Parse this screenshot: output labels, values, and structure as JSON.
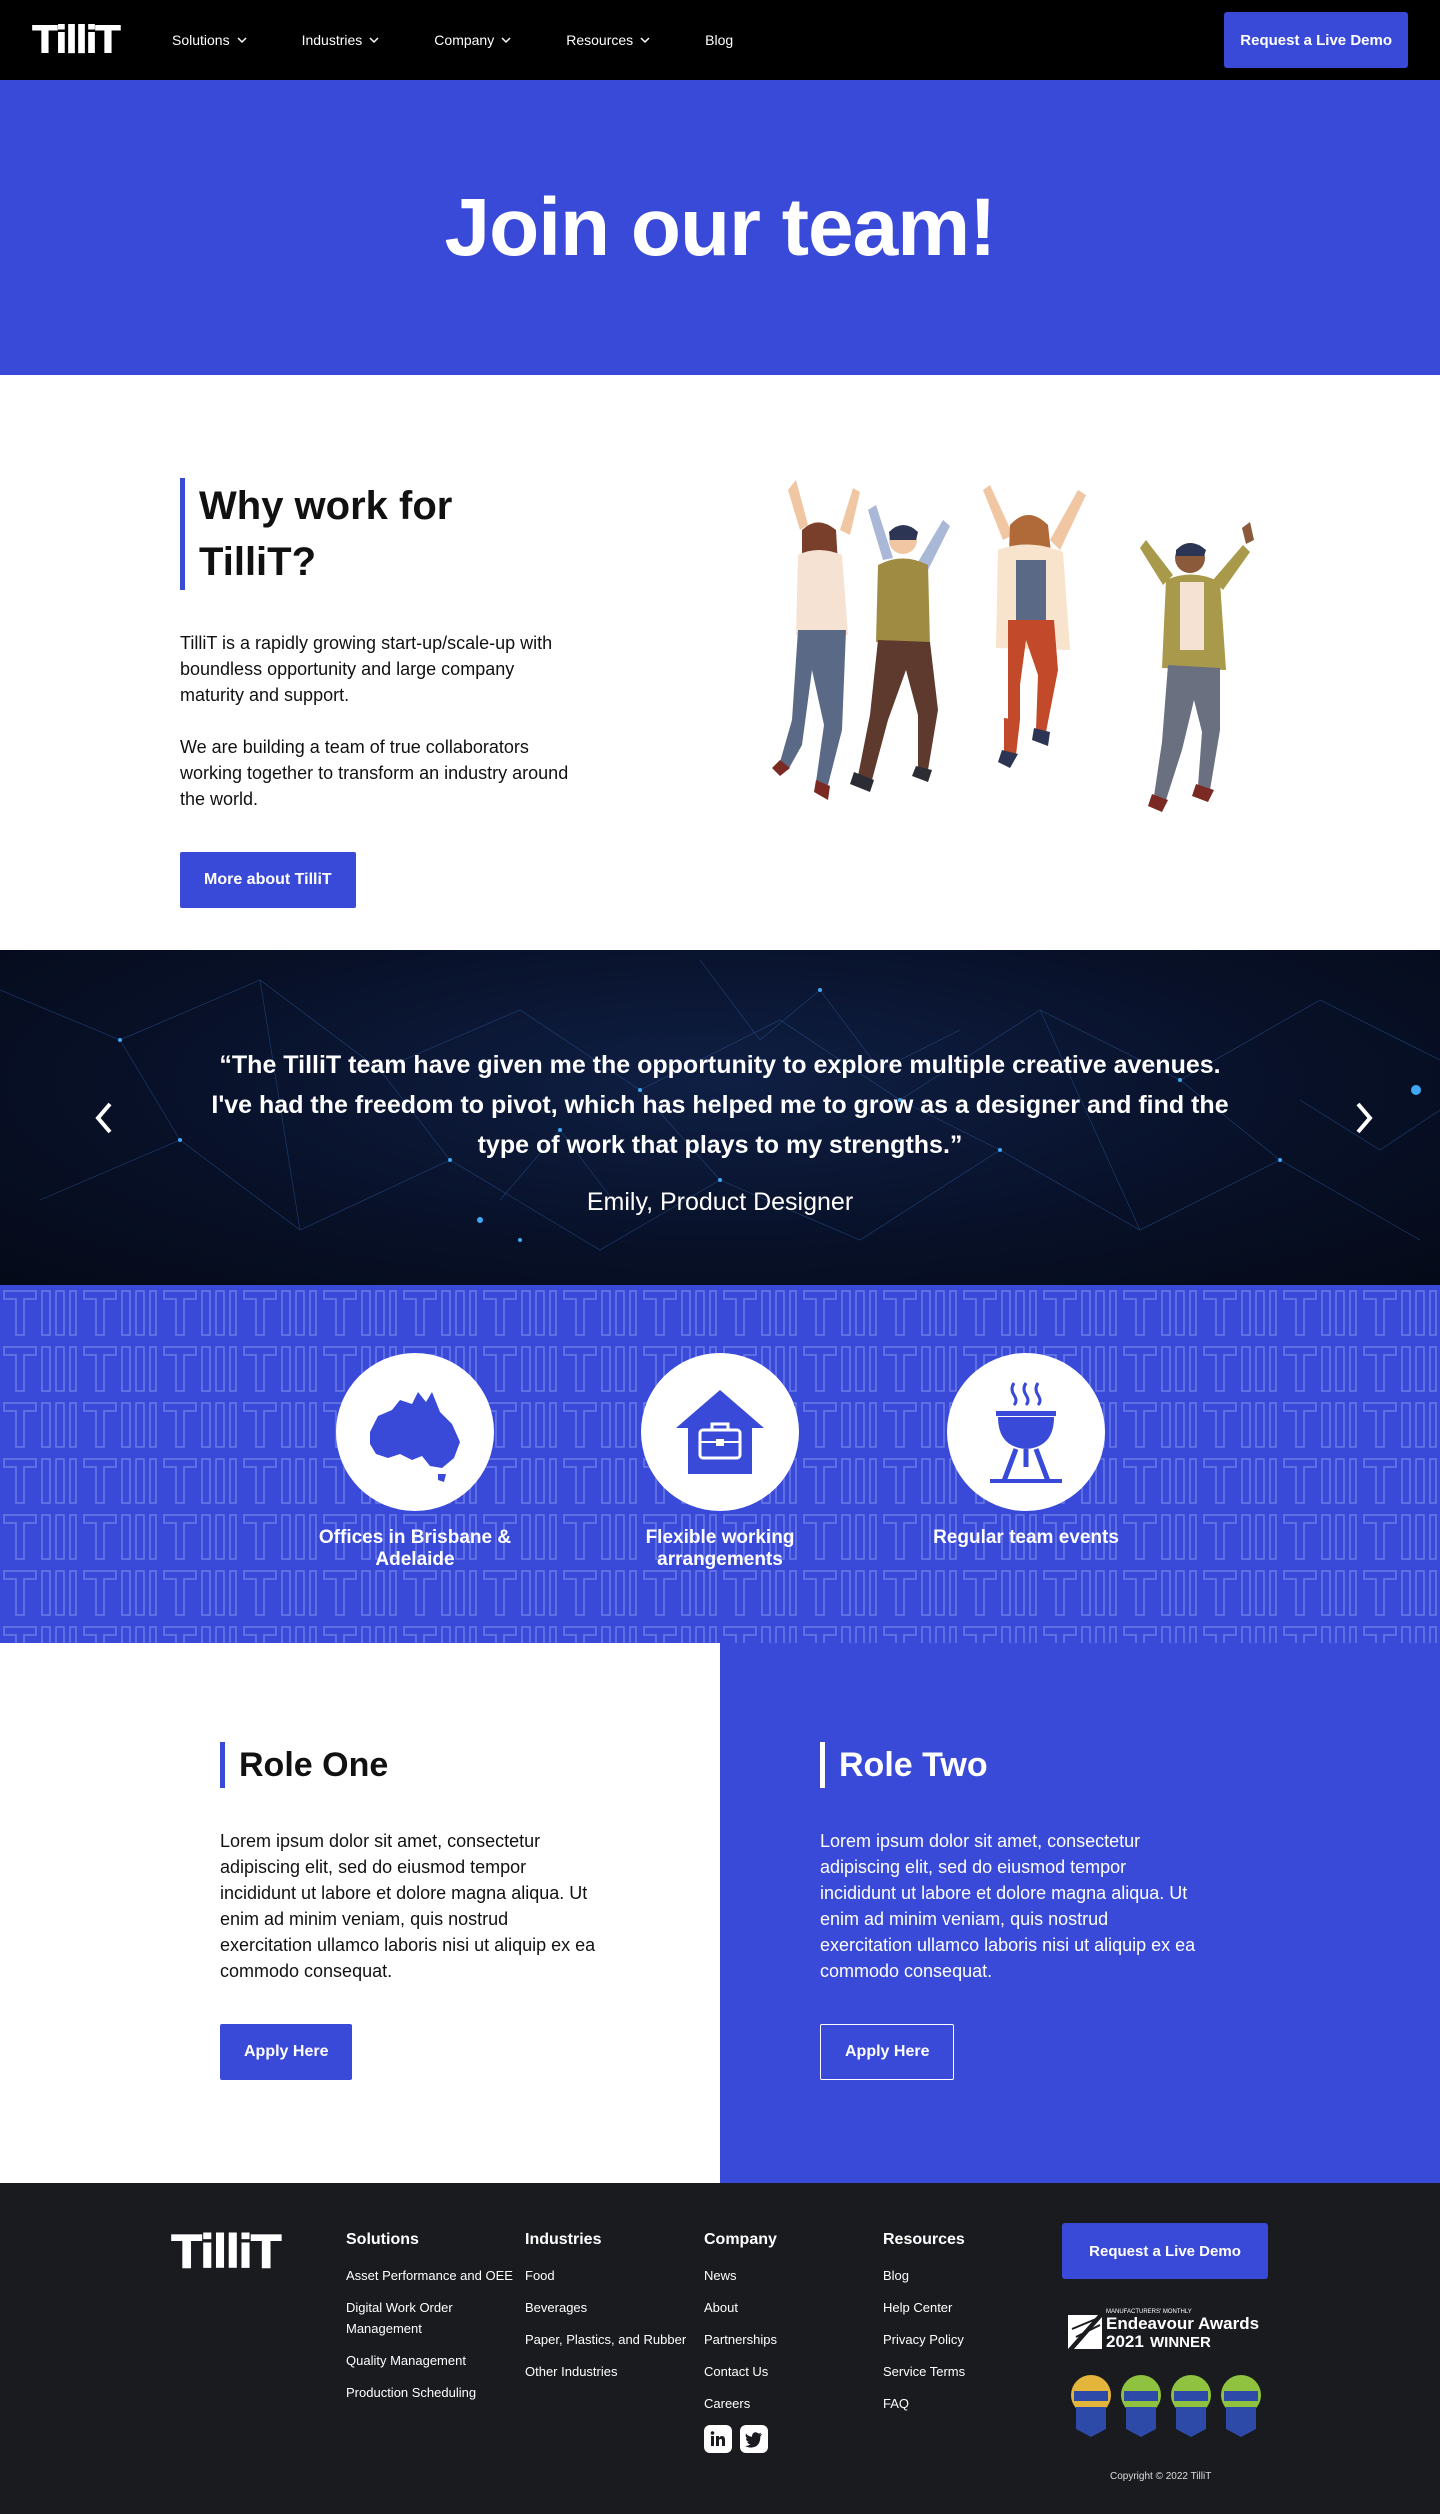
{
  "nav": {
    "logo": "TilliT",
    "items": [
      {
        "label": "Solutions",
        "has_dropdown": true
      },
      {
        "label": "Industries",
        "has_dropdown": true
      },
      {
        "label": "Company",
        "has_dropdown": true
      },
      {
        "label": "Resources",
        "has_dropdown": true
      },
      {
        "label": "Blog",
        "has_dropdown": false
      }
    ],
    "cta": "Request a Live Demo"
  },
  "hero": {
    "title": "Join our team!"
  },
  "why": {
    "title": "Why work for TilliT?",
    "paragraphs": [
      "TilliT is a rapidly growing start-up/scale-up with boundless opportunity and large company maturity and support.",
      "We are building a team of true collaborators working together to transform an industry around the world."
    ],
    "button": "More about TilliT"
  },
  "testimonial": {
    "quote": "“The TilliT team have given me the opportunity to explore multiple creative avenues. I've had the freedom to pivot, which has helped me to grow as a designer and find the type of work that plays to my strengths.”",
    "author": "Emily, Product Designer"
  },
  "benefits": [
    {
      "label": "Offices in Brisbane & Adelaide",
      "icon": "australia-map-icon"
    },
    {
      "label": "Flexible working arrangements",
      "icon": "house-briefcase-icon"
    },
    {
      "label": "Regular team events",
      "icon": "bbq-grill-icon"
    }
  ],
  "roles": [
    {
      "title": "Role One",
      "description": "Lorem ipsum dolor sit amet, consectetur adipiscing elit, sed do eiusmod tempor incididunt ut labore et dolore magna aliqua. Ut enim ad minim veniam, quis nostrud exercitation ullamco laboris nisi ut aliquip ex ea commodo consequat.",
      "button": "Apply Here"
    },
    {
      "title": "Role Two",
      "description": "Lorem ipsum dolor sit amet, consectetur adipiscing elit, sed do eiusmod tempor incididunt ut labore et dolore magna aliqua. Ut enim ad minim veniam, quis nostrud exercitation ullamco laboris nisi ut aliquip ex ea commodo consequat.",
      "button": "Apply Here"
    }
  ],
  "footer": {
    "logo": "TilliT",
    "columns": [
      {
        "title": "Solutions",
        "links": [
          "Asset Performance and OEE",
          "Digital Work Order Management",
          "Quality Management",
          "Production Scheduling"
        ]
      },
      {
        "title": "Industries",
        "links": [
          "Food",
          "Beverages",
          "Paper, Plastics, and Rubber",
          "Other Industries"
        ]
      },
      {
        "title": "Company",
        "links": [
          "News",
          "About",
          "Partnerships",
          "Contact Us",
          "Careers"
        ]
      },
      {
        "title": "Resources",
        "links": [
          "Blog",
          "Help Center",
          "Privacy Policy",
          "Service Terms",
          "FAQ"
        ]
      }
    ],
    "cta": "Request a Live Demo",
    "award": {
      "small": "MANUFACTURERS' MONTHLY",
      "name": "Endeavour Awards",
      "year": "2021",
      "suffix": "WINNER"
    },
    "copyright": "Copyright © 2022 TilliT"
  },
  "colors": {
    "brand": "#3949d8",
    "nav_bg": "#000000",
    "footer_bg": "#1a1b1f"
  }
}
